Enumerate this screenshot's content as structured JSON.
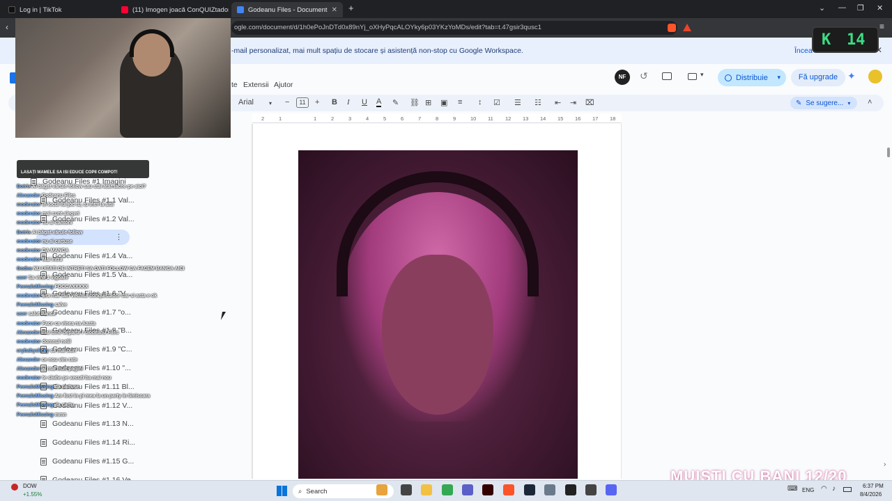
{
  "tabs": [
    {
      "label": "Log in | TikTok"
    },
    {
      "label": "(11) Imogen joacă ConQUIZtador (m"
    },
    {
      "label": "Godeanu Files - Documente Goo"
    }
  ],
  "address": {
    "url": "ogle.com/document/d/1h0ePoJnDTd0x89nYj_oXHyPqcALOYky6p03YKzYoMDs/edit?tab=t.47gsir3qusc1"
  },
  "banner": {
    "text": "-mail personalizat, mai mult spațiu de stocare și asistență non-stop cu Google Workspace.",
    "link": "Încea"
  },
  "menus": [
    "te",
    "Extensii",
    "Ajutor"
  ],
  "header": {
    "share_label": "Distribuie",
    "upgrade_label": "Fă upgrade",
    "avatar_initials": "NF"
  },
  "toolbar": {
    "font": "Arial",
    "font_size": "11",
    "suggest_label": "Se sugere..."
  },
  "ruler": [
    "2",
    "1",
    "1",
    "2",
    "3",
    "4",
    "5",
    "6",
    "7",
    "8",
    "9",
    "10",
    "11",
    "12",
    "13",
    "14",
    "15",
    "16",
    "17",
    "18"
  ],
  "outline": {
    "items": [
      "Godeanu Files #1 Imagini",
      "Godeanu Files #1.1 Val...",
      "Godeanu Files #1.2 Val...",
      "Godeanu Files #...",
      "Godeanu Files #1.4 Va...",
      "Godeanu Files #1.5 Va...",
      "Godeanu Files #1.6 \"V...",
      "Godeanu Files #1.7 \"o...",
      "Godeanu Files #1.8 \"B...",
      "Godeanu Files #1.9 \"C...",
      "Godeanu Files #1.10 \"...",
      "Godeanu Files #1.11 Bl...",
      "Godeanu Files #1.12 V...",
      "Godeanu Files #1.13 N...",
      "Godeanu Files #1.14 Ri...",
      "Godeanu Files #1.15 G...",
      "Godeanu Files #1.16 Ve..."
    ]
  },
  "chat": {
    "alert": "LASAȚI MAMELE SA ISI EDUCE COPII COMPOT!",
    "messages": [
      {
        "user": "Botrix",
        "text": "Ai băgat vărule follow sau stai ătărnache pe aici?"
      },
      {
        "user": "Alexander",
        "text": "Godeanu Files"
      },
      {
        "user": "moderator",
        "text": "In locul lui joc tu, tu intri la altii"
      },
      {
        "user": "moderator",
        "text": "mai sunt alegeri"
      },
      {
        "user": "moderator",
        "text": "nu ai cantoni"
      },
      {
        "user": "Botrix",
        "text": "Ai băgat vărule follow"
      },
      {
        "user": "moderator",
        "text": "nu ai cartuse"
      },
      {
        "user": "moderator",
        "text": "DA MANCA"
      },
      {
        "user": "moderator",
        "text": "Mai intra"
      },
      {
        "user": "Godea",
        "text": "NU UITATI DE INTRETI SA DATI FOLLOW CA FACEM BANCA AICI"
      },
      {
        "user": "user",
        "text": "Sa vina 1 vigoare"
      },
      {
        "user": "PeenalsMissing",
        "text": "FOCCAXXXXX"
      },
      {
        "user": "moderator",
        "text": "Era mai fain vechiul conquistador dar si asta e ok"
      },
      {
        "user": "PeenalsMissing",
        "text": "salve"
      },
      {
        "user": "user",
        "text": "salut Panca"
      },
      {
        "user": "moderator",
        "text": "Face ca vinea na Aasta"
      },
      {
        "user": "Alexander",
        "text": "mai bine departe r Godeanu Files"
      },
      {
        "user": "moderator",
        "text": "domnul nelil"
      },
      {
        "user": "crybabyslicky",
        "text": "ca mai bun"
      },
      {
        "user": "Alexander",
        "text": "ce nou vim rate"
      },
      {
        "user": "Alexander",
        "text": "ai mai mult pagini"
      },
      {
        "user": "moderator",
        "text": "te siwhe pe xecuti ba mai nou"
      },
      {
        "user": "PeenalsMissing",
        "text": "da cartuse"
      },
      {
        "user": "PeenalsMissing",
        "text": "Am fost in pi mea la un party in timisoara"
      },
      {
        "user": "PeenalsMissing",
        "text": "da cartu"
      },
      {
        "user": "PeenalsMissing",
        "text": "mmn"
      }
    ]
  },
  "overlay": {
    "counter_k": "K",
    "counter_num": "14",
    "muisti": "MUISTI CU BANI 12/20"
  },
  "taskbar": {
    "stock_name": "DOW",
    "stock_change": "+1.55%",
    "search_placeholder": "Search",
    "lang": "ENG",
    "time": "6:37 PM",
    "date": "8/4/2026"
  },
  "colors": {
    "accent": "#0b57d0",
    "share_bg": "#c2e7ff",
    "tabbar": "#202124",
    "counter_green": "#3ddc84"
  }
}
